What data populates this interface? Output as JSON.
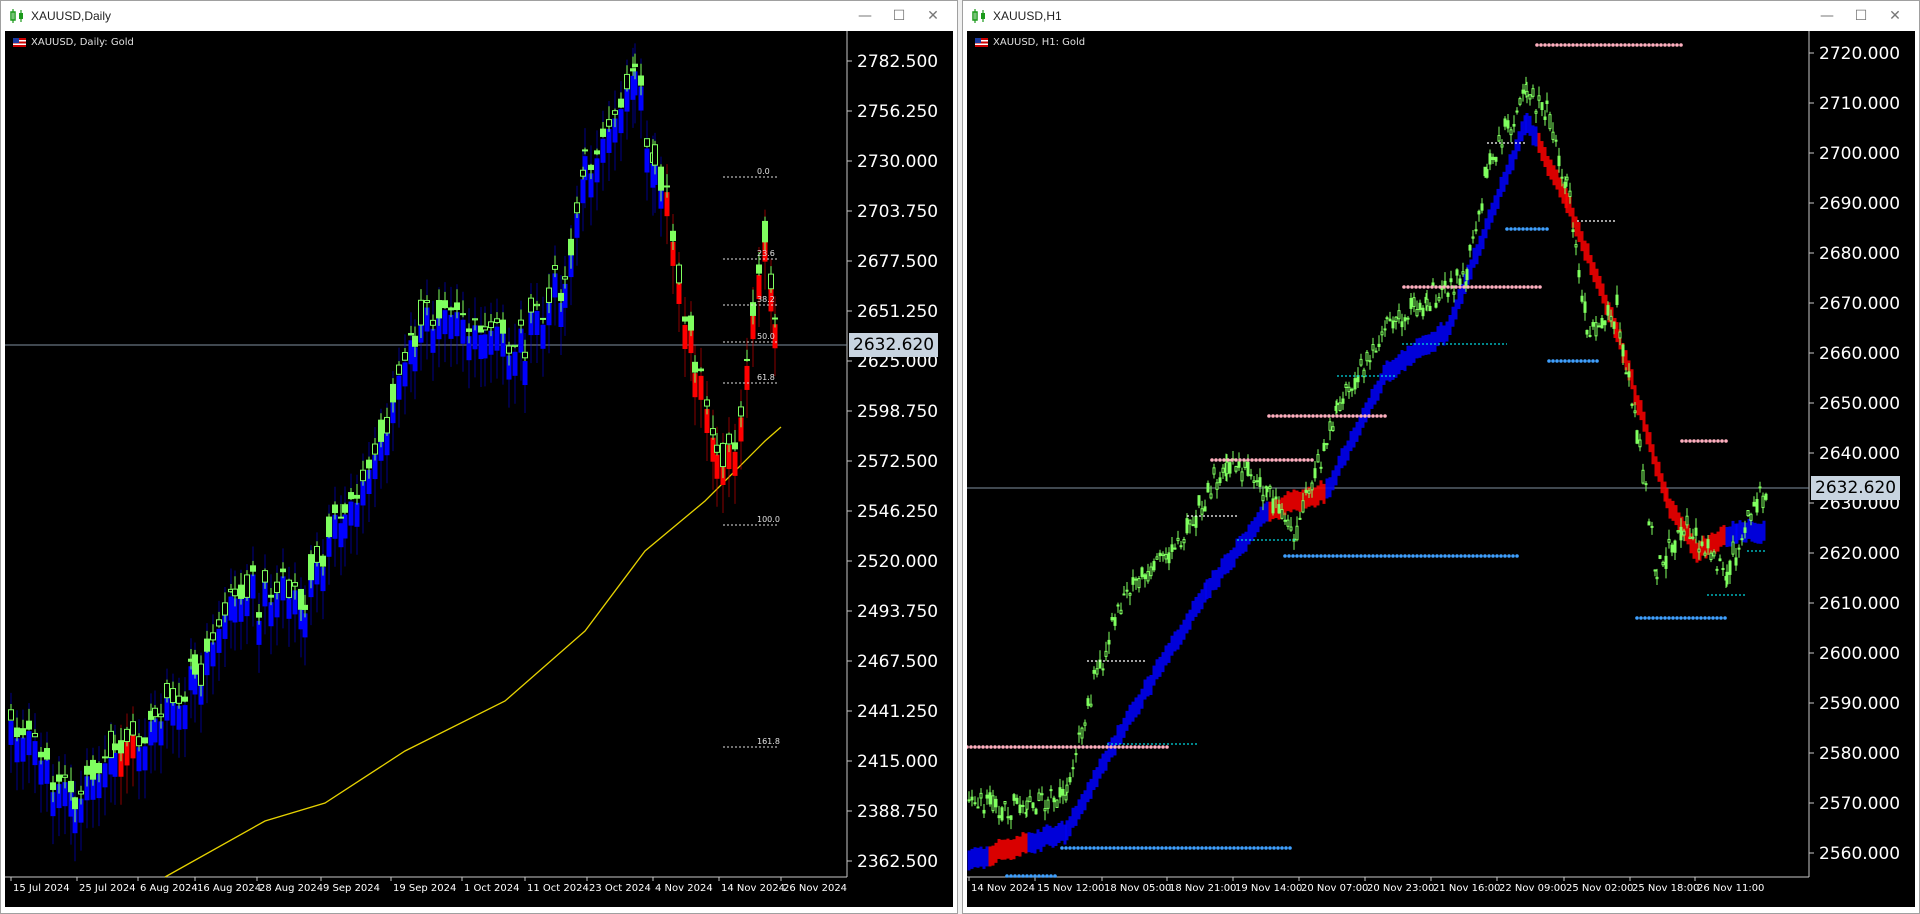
{
  "windows": [
    {
      "title": "XAUUSD,Daily",
      "chart_label": "XAUUSD, Daily:  Gold",
      "price_labels": [
        "2782.500",
        "2756.250",
        "2730.000",
        "2703.750",
        "2677.500",
        "2651.250",
        "2625.000",
        "2598.750",
        "2572.500",
        "2546.250",
        "2520.000",
        "2493.750",
        "2467.500",
        "2441.250",
        "2415.000",
        "2388.750",
        "2362.500"
      ],
      "current_price": "2632.620",
      "date_labels": [
        "15 Jul 2024",
        "25 Jul 2024",
        "6 Aug 2024",
        "16 Aug 2024",
        "28 Aug 2024",
        "9 Sep 2024",
        "19 Sep 2024",
        "1 Oct 2024",
        "11 Oct 2024",
        "23 Oct 2024",
        "4 Nov 2024",
        "14 Nov 2024",
        "26 Nov 2024"
      ],
      "fib_labels": [
        "0.0",
        "23.6",
        "38.2",
        "50.0",
        "61.8",
        "100.0",
        "161.8"
      ]
    },
    {
      "title": "XAUUSD,H1",
      "chart_label": "XAUUSD, H1:  Gold",
      "price_labels": [
        "2720.000",
        "2710.000",
        "2700.000",
        "2690.000",
        "2680.000",
        "2670.000",
        "2660.000",
        "2650.000",
        "2640.000",
        "2630.000",
        "2620.000",
        "2610.000",
        "2600.000",
        "2590.000",
        "2580.000",
        "2570.000",
        "2560.000"
      ],
      "current_price": "2632.620",
      "date_labels": [
        "14 Nov 2024",
        "15 Nov 12:00",
        "18 Nov 05:00",
        "18 Nov 21:00",
        "19 Nov 14:00",
        "20 Nov 07:00",
        "20 Nov 23:00",
        "21 Nov 16:00",
        "22 Nov 09:00",
        "25 Nov 02:00",
        "25 Nov 18:00",
        "26 Nov 11:00"
      ]
    }
  ],
  "window_buttons": {
    "minimize": "—",
    "maximize": "☐",
    "close": "✕"
  },
  "colors": {
    "bull": "#7fff5f",
    "bear_band": "#ff0000",
    "bull_band": "#0000ff",
    "ma": "#e6d200",
    "dot_pink": "#ffb0c0",
    "dot_blue": "#3fa0ff",
    "dot_cyan": "#00d8e0"
  }
}
